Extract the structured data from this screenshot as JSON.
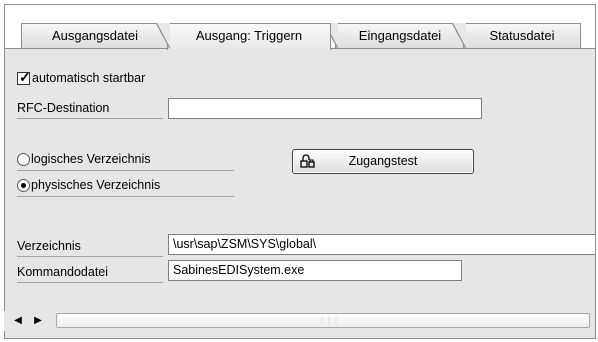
{
  "tabs": [
    {
      "label": "Ausgangsdatei",
      "active": false
    },
    {
      "label": "Ausgang: Triggern",
      "active": true
    },
    {
      "label": "Eingangsdatei",
      "active": false
    },
    {
      "label": "Statusdatei",
      "active": false
    }
  ],
  "form": {
    "auto_start_label": "automatisch startbar",
    "auto_start_checked": true,
    "rfc_label": "RFC-Destination",
    "rfc_value": "",
    "radio_logical_label": "logisches Verzeichnis",
    "radio_physical_label": "physisches Verzeichnis",
    "radio_selected": "physical",
    "access_test_label": "Zugangstest",
    "directory_label": "Verzeichnis",
    "directory_value": "\\usr\\sap\\ZSM\\SYS\\global\\",
    "command_file_label": "Kommandodatei",
    "command_file_value": "SabinesEDISystem.exe"
  },
  "scrollbar": {
    "left_icon": "arrow-left-icon",
    "right_icon": "arrow-right-icon"
  }
}
